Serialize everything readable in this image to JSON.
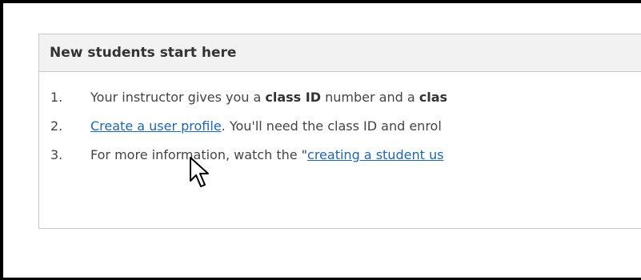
{
  "panel": {
    "title": "New students start here"
  },
  "steps": [
    {
      "number": "1.",
      "text_before": "Your instructor gives you a ",
      "bold_1": "class ID",
      "text_middle": " number and a ",
      "bold_2": "clas"
    },
    {
      "number": "2.",
      "link_text": "Create a user profile",
      "text_after": ". You'll need the class ID and enrol"
    },
    {
      "number": "3.",
      "text_before": "For more information, watch the \"",
      "link_text": "creating a student us"
    }
  ],
  "icons": {
    "cursor": "mouse-pointer-arrow-icon"
  }
}
